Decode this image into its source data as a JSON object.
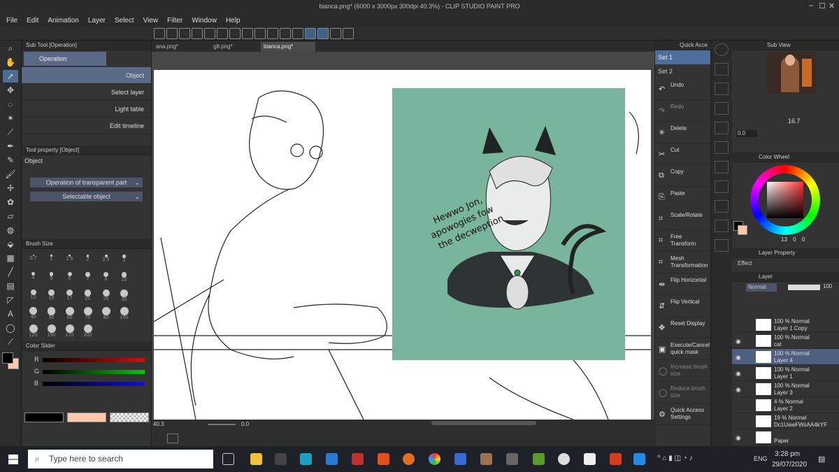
{
  "window": {
    "title": "bianca.png* (6000 x 3000px 300dpi 40.3%)  - CLIP STUDIO PAINT PRO"
  },
  "menu": [
    "File",
    "Edit",
    "Animation",
    "Layer",
    "Select",
    "View",
    "Filter",
    "Window",
    "Help"
  ],
  "subtool": {
    "header": "Sub Tool [Operation]",
    "group": "Operation",
    "items": [
      "Object",
      "Select layer",
      "Light table",
      "Edit timeline"
    ]
  },
  "toolprop": {
    "header": "Tool property [Object]",
    "title": "Object",
    "dropdown1": "Operation of transparent part",
    "dropdown2": "Selectable object"
  },
  "brushsize": {
    "header": "Brush Size",
    "sizes": [
      "0.7",
      "1",
      "1.5",
      "2",
      "2.5",
      "3",
      "4",
      "5",
      "6",
      "7",
      "8",
      "10",
      "12",
      "15",
      "17",
      "20",
      "25",
      "30",
      "40",
      "50",
      "60",
      "70",
      "80",
      "100",
      "120",
      "150",
      "170",
      "200"
    ]
  },
  "colorslider": {
    "header": "Color Slider",
    "channels": [
      {
        "name": "R",
        "value": "0",
        "color": "#d01010"
      },
      {
        "name": "G",
        "value": "0",
        "color": "#10c010"
      },
      {
        "name": "B",
        "value": "0",
        "color": "#1010d0"
      }
    ]
  },
  "tabs": [
    "ana.png*",
    "g8.png*",
    "bianca.png*"
  ],
  "status": {
    "zoom": "40.3",
    "rotation": "0.0"
  },
  "drawing": {
    "note_lines": [
      "Hewwo Jon,",
      "apowogies fow",
      "the decweption"
    ],
    "card_color": "#79b49c"
  },
  "quickaccess": {
    "header": "Quick Acce",
    "sets": [
      "Set 1",
      "Set 2"
    ],
    "items": [
      {
        "icon": "↶",
        "label": "Undo",
        "dim": false
      },
      {
        "icon": "↷",
        "label": "Redo",
        "dim": true
      },
      {
        "icon": "✳",
        "label": "Delete",
        "dim": false
      },
      {
        "icon": "✂",
        "label": "Cut",
        "dim": false
      },
      {
        "icon": "⧉",
        "label": "Copy",
        "dim": false
      },
      {
        "icon": "⎘",
        "label": "Paste",
        "dim": false
      },
      {
        "icon": "⌗",
        "label": "Scale/Rotate",
        "dim": false
      },
      {
        "icon": "⌗",
        "label": "Free Transform",
        "dim": false
      },
      {
        "icon": "⌗",
        "label": "Mesh Transformation",
        "dim": false
      },
      {
        "icon": "⇹",
        "label": "Flip Horizontal",
        "dim": false
      },
      {
        "icon": "⇵",
        "label": "Flip Vertical",
        "dim": false
      },
      {
        "icon": "✥",
        "label": "Reset Display",
        "dim": false
      },
      {
        "icon": "▣",
        "label": "Execute/Cancel quick mask",
        "dim": false
      },
      {
        "icon": "◯",
        "label": "Increase brush size",
        "dim": true
      },
      {
        "icon": "◯",
        "label": "Reduce brush size",
        "dim": true
      },
      {
        "icon": "⚙",
        "label": "Quick Access Settings",
        "dim": false
      }
    ]
  },
  "subview": {
    "header": "Sub View",
    "zoom": "16.7",
    "angle": "0.0"
  },
  "colorwheel": {
    "header": "Color Wheel",
    "values": [
      "13",
      "0",
      "0"
    ]
  },
  "layerprop": {
    "header": "Layer Property",
    "effect": "Effect"
  },
  "layers": {
    "header": "Layer",
    "blend": "Normal",
    "opacity": "100",
    "rows": [
      {
        "line1": "100 % Normal",
        "line2": "Layer 1 Copy",
        "visible": false,
        "selected": false
      },
      {
        "line1": "100 % Normal",
        "line2": "cat",
        "visible": true,
        "selected": false
      },
      {
        "line1": "100 % Normal",
        "line2": "Layer 4",
        "visible": true,
        "selected": true
      },
      {
        "line1": "100 % Normal",
        "line2": "Layer 1",
        "visible": true,
        "selected": false
      },
      {
        "line1": "100 % Normal",
        "line2": "Layer 3",
        "visible": true,
        "selected": false
      },
      {
        "line1": "4 % Normal",
        "line2": "Layer 2",
        "visible": false,
        "selected": false
      },
      {
        "line1": "19 % Normal",
        "line2": "Dc1UawFWsAA4kYF",
        "visible": false,
        "selected": false
      },
      {
        "line1": "",
        "line2": "Paper",
        "visible": true,
        "selected": false
      }
    ]
  },
  "taskbar": {
    "search_placeholder": "Type here to search",
    "time": "3:28 pm",
    "date": "29/07/2020",
    "lang": "ENG"
  }
}
